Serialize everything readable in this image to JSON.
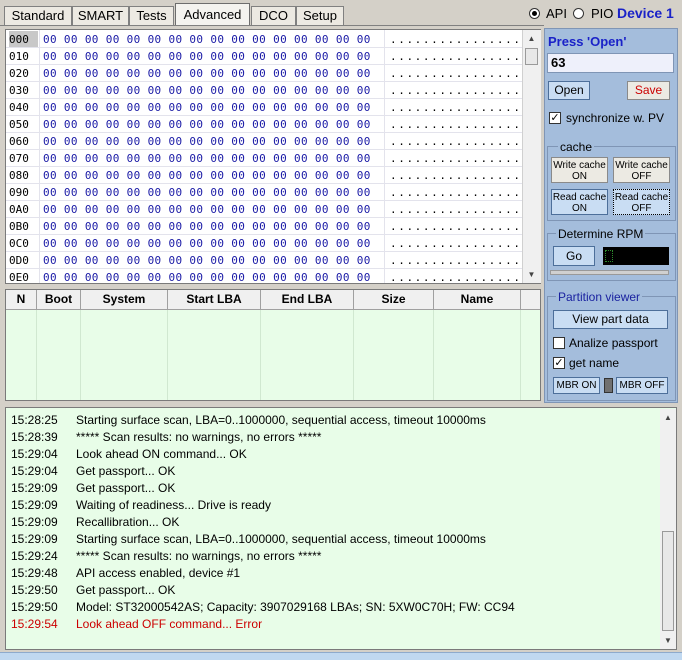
{
  "tabs": [
    {
      "label": "Standard"
    },
    {
      "label": "SMART"
    },
    {
      "label": "Tests"
    },
    {
      "label": "Advanced"
    },
    {
      "label": "DCO"
    },
    {
      "label": "Setup"
    }
  ],
  "mode": {
    "api_label": "API",
    "pio_label": "PIO",
    "device_label": "Device 1"
  },
  "hex": {
    "rows": [
      {
        "addr": "000",
        "bytes": "00 00 00 00 00 00 00 00 00 00 00 00 00 00 00 00",
        "ascii": "................"
      },
      {
        "addr": "010",
        "bytes": "00 00 00 00 00 00 00 00 00 00 00 00 00 00 00 00",
        "ascii": "................"
      },
      {
        "addr": "020",
        "bytes": "00 00 00 00 00 00 00 00 00 00 00 00 00 00 00 00",
        "ascii": "................"
      },
      {
        "addr": "030",
        "bytes": "00 00 00 00 00 00 00 00 00 00 00 00 00 00 00 00",
        "ascii": "................"
      },
      {
        "addr": "040",
        "bytes": "00 00 00 00 00 00 00 00 00 00 00 00 00 00 00 00",
        "ascii": "................"
      },
      {
        "addr": "050",
        "bytes": "00 00 00 00 00 00 00 00 00 00 00 00 00 00 00 00",
        "ascii": "................"
      },
      {
        "addr": "060",
        "bytes": "00 00 00 00 00 00 00 00 00 00 00 00 00 00 00 00",
        "ascii": "................"
      },
      {
        "addr": "070",
        "bytes": "00 00 00 00 00 00 00 00 00 00 00 00 00 00 00 00",
        "ascii": "................"
      },
      {
        "addr": "080",
        "bytes": "00 00 00 00 00 00 00 00 00 00 00 00 00 00 00 00",
        "ascii": "................"
      },
      {
        "addr": "090",
        "bytes": "00 00 00 00 00 00 00 00 00 00 00 00 00 00 00 00",
        "ascii": "................"
      },
      {
        "addr": "0A0",
        "bytes": "00 00 00 00 00 00 00 00 00 00 00 00 00 00 00 00",
        "ascii": "................"
      },
      {
        "addr": "0B0",
        "bytes": "00 00 00 00 00 00 00 00 00 00 00 00 00 00 00 00",
        "ascii": "................"
      },
      {
        "addr": "0C0",
        "bytes": "00 00 00 00 00 00 00 00 00 00 00 00 00 00 00 00",
        "ascii": "................"
      },
      {
        "addr": "0D0",
        "bytes": "00 00 00 00 00 00 00 00 00 00 00 00 00 00 00 00",
        "ascii": "................"
      },
      {
        "addr": "0E0",
        "bytes": "00 00 00 00 00 00 00 00 00 00 00 00 00 00 00 00",
        "ascii": "................"
      }
    ]
  },
  "partition_table": {
    "columns": [
      "N",
      "Boot",
      "System",
      "Start LBA",
      "End LBA",
      "Size",
      "Name"
    ]
  },
  "sidebar": {
    "press_open_label": "Press 'Open'",
    "sector_value": "63",
    "open_label": "Open",
    "save_label": "Save",
    "sync_label": "synchronize w. PV",
    "sync_checked": true,
    "cache_label": "cache",
    "write_on_label": "Write cache ON",
    "write_off_label": "Write cache OFF",
    "read_on_label": "Read cache ON",
    "read_off_label": "Read cache OFF",
    "rpm_label": "Determine RPM",
    "go_label": "Go",
    "partition_viewer_label": "Partition viewer",
    "view_part_label": "View part data",
    "analize_label": "Analize passport",
    "analize_checked": false,
    "get_name_label": "get name",
    "get_name_checked": true,
    "mbr_on_label": "MBR ON",
    "mbr_off_label": "MBR OFF"
  },
  "log": {
    "error_color": "#cc0000",
    "lines": [
      {
        "time": "15:28:25",
        "msg": "Starting surface scan, LBA=0..1000000, sequential access, timeout 10000ms",
        "error": false
      },
      {
        "time": "15:28:39",
        "msg": "***** Scan results: no warnings, no errors *****",
        "error": false
      },
      {
        "time": "15:29:04",
        "msg": "Look ahead ON command... OK",
        "error": false
      },
      {
        "time": "15:29:04",
        "msg": "Get passport... OK",
        "error": false
      },
      {
        "time": "15:29:09",
        "msg": "Get passport... OK",
        "error": false
      },
      {
        "time": "15:29:09",
        "msg": "Waiting of readiness... Drive is ready",
        "error": false
      },
      {
        "time": "15:29:09",
        "msg": "Recallibration... OK",
        "error": false
      },
      {
        "time": "15:29:09",
        "msg": "Starting surface scan, LBA=0..1000000, sequential access, timeout 10000ms",
        "error": false
      },
      {
        "time": "15:29:24",
        "msg": "***** Scan results: no warnings, no errors *****",
        "error": false
      },
      {
        "time": "15:29:48",
        "msg": "API access enabled, device #1",
        "error": false
      },
      {
        "time": "15:29:50",
        "msg": "Get passport... OK",
        "error": false
      },
      {
        "time": "15:29:50",
        "msg": "Model: ST32000542AS; Capacity: 3907029168 LBAs; SN: 5XW0C70H; FW: CC94",
        "error": false
      },
      {
        "time": "15:29:54",
        "msg": "Look ahead OFF command... Error",
        "error": true
      }
    ]
  }
}
